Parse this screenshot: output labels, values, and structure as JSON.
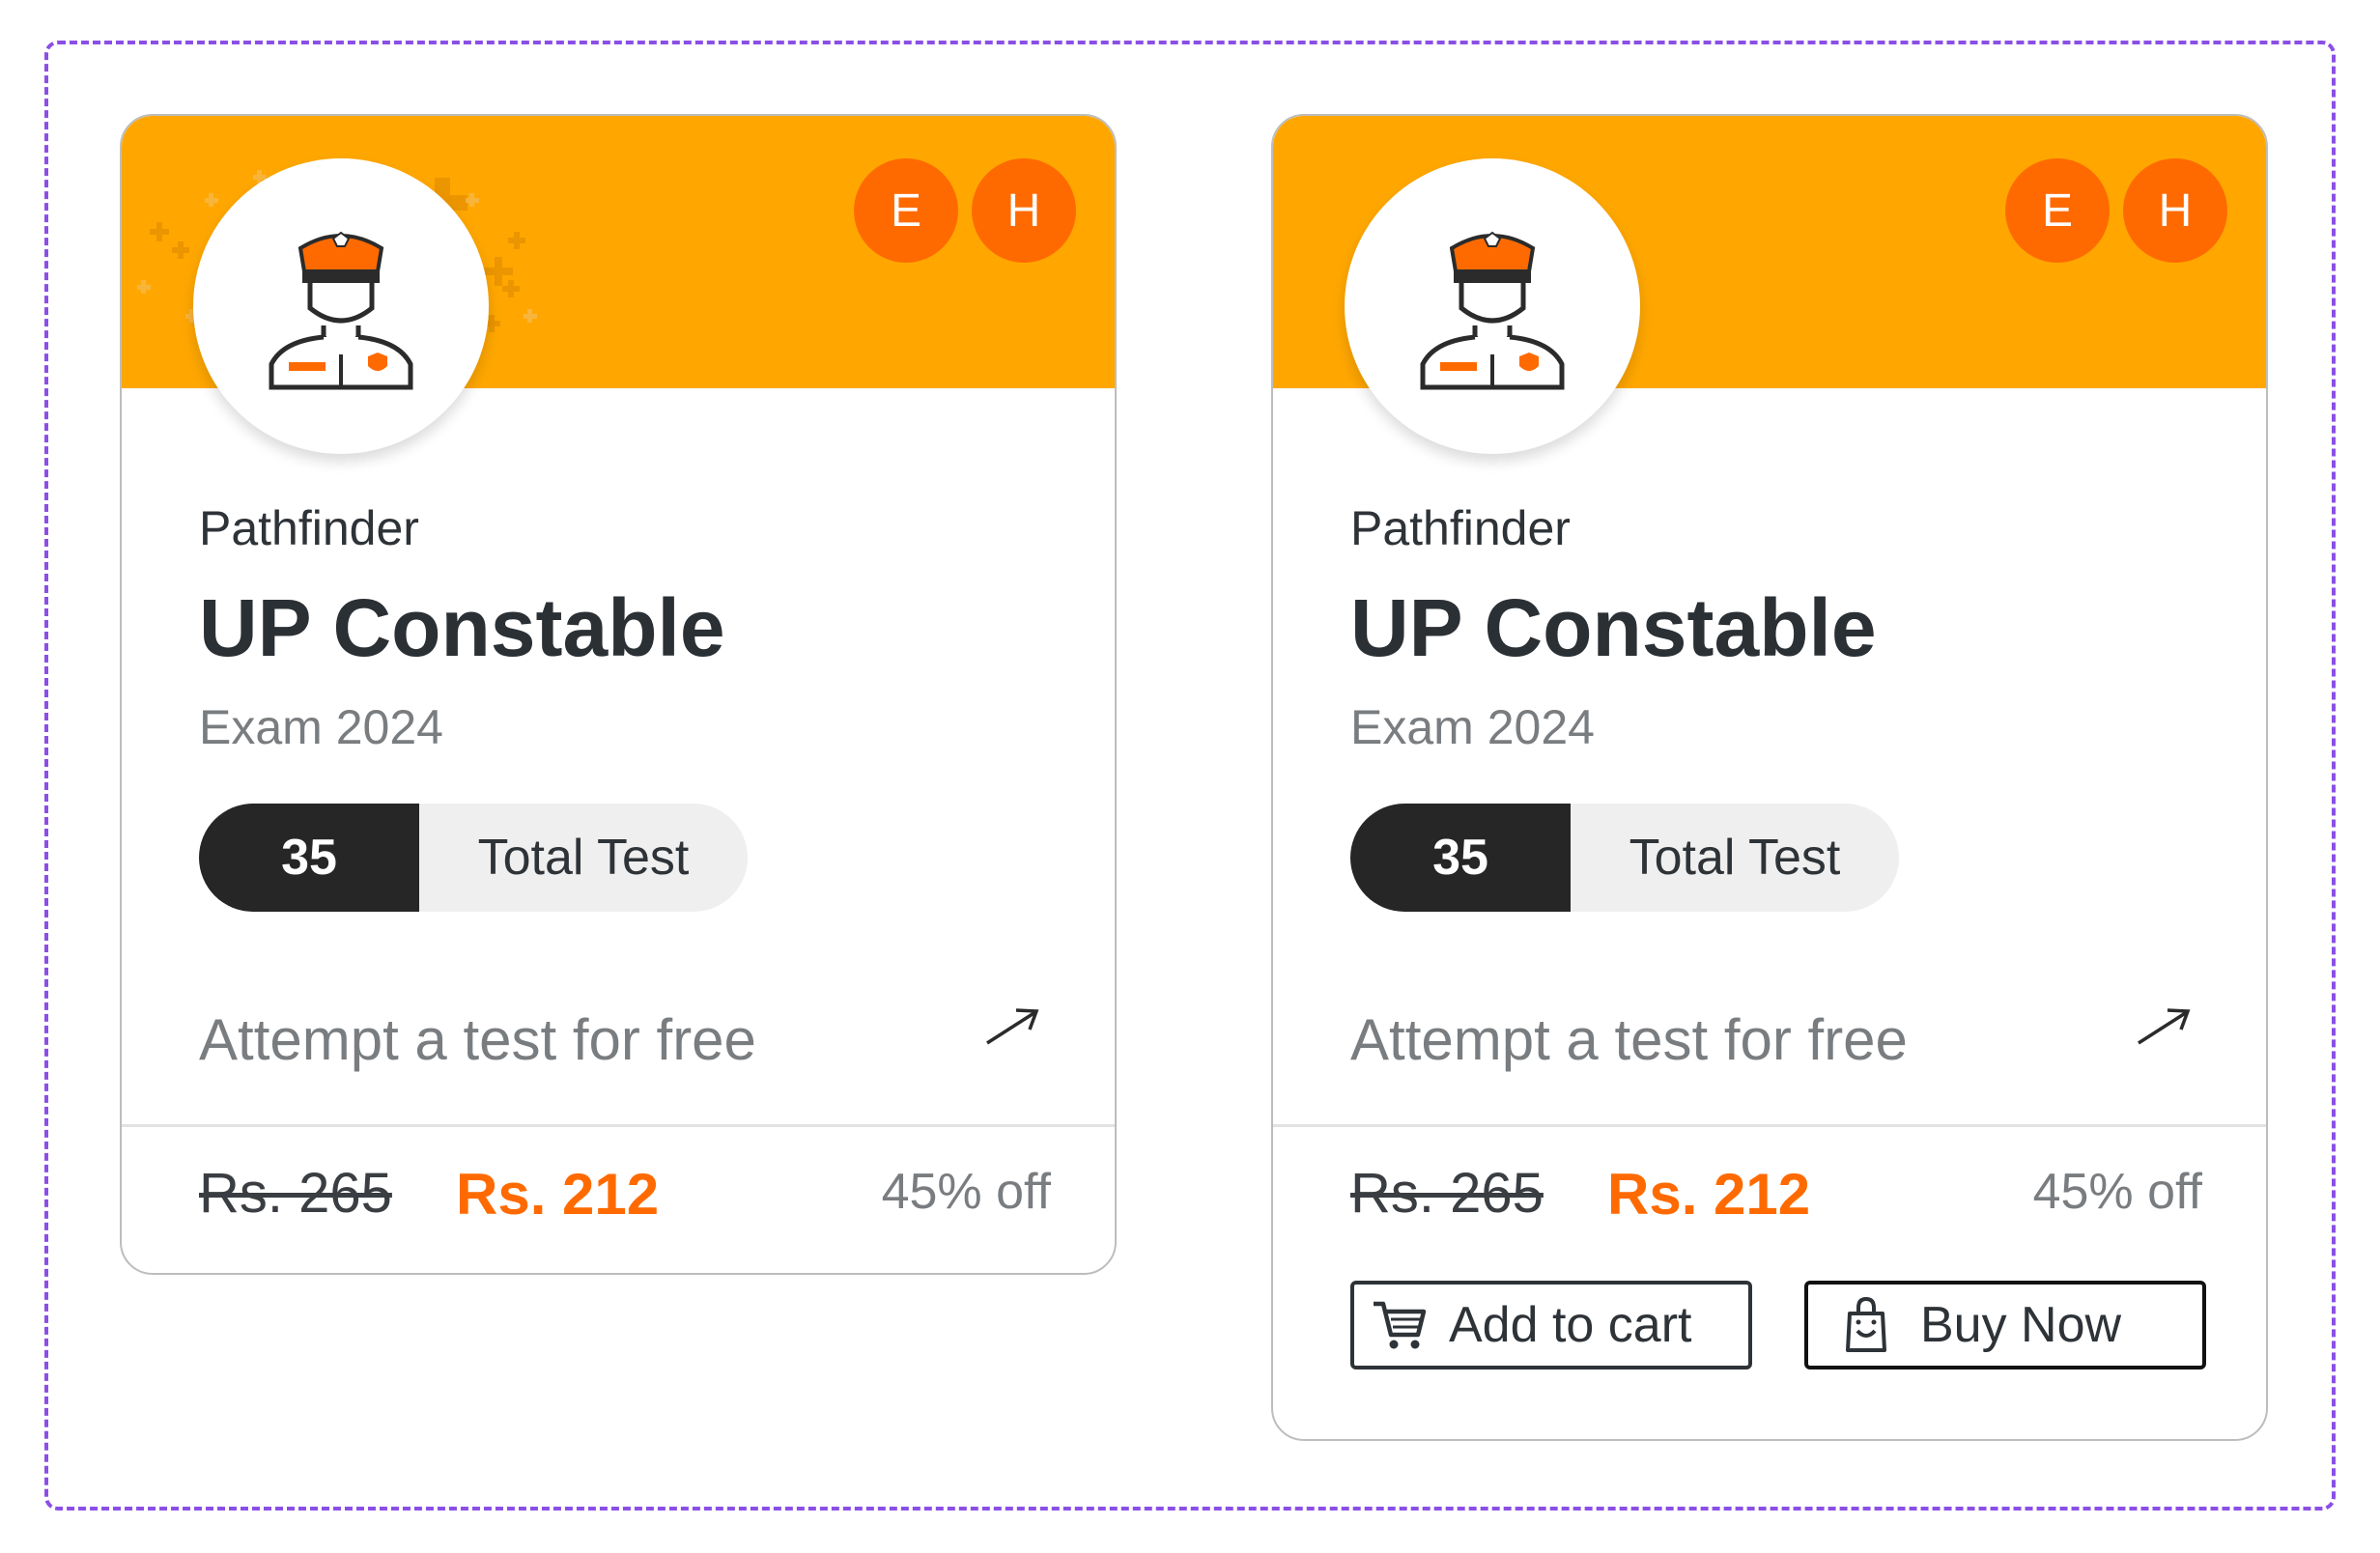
{
  "cards": [
    {
      "provider": "Pathfinder",
      "title": "UP Constable",
      "subtitle": "Exam 2024",
      "languages": [
        "E",
        "H"
      ],
      "test_count": "35",
      "test_count_label": "Total Test",
      "free_attempt_label": "Attempt a test for free",
      "original_price": "Rs. 265",
      "price": "Rs. 212",
      "discount": "45% off",
      "avatar_icon": "police-officer-icon",
      "banner_pattern": true
    },
    {
      "provider": "Pathfinder",
      "title": "UP Constable",
      "subtitle": "Exam 2024",
      "languages": [
        "E",
        "H"
      ],
      "test_count": "35",
      "test_count_label": "Total Test",
      "free_attempt_label": "Attempt a test for free",
      "original_price": "Rs. 265",
      "price": "Rs. 212",
      "discount": "45% off",
      "avatar_icon": "police-officer-icon",
      "banner_pattern": false,
      "add_to_cart_label": "Add to cart",
      "buy_now_label": "Buy Now"
    }
  ],
  "colors": {
    "banner": "#ffa700",
    "accent": "#ff6a00",
    "frame_border": "#8b4fe6",
    "pill_dark": "#262626"
  }
}
